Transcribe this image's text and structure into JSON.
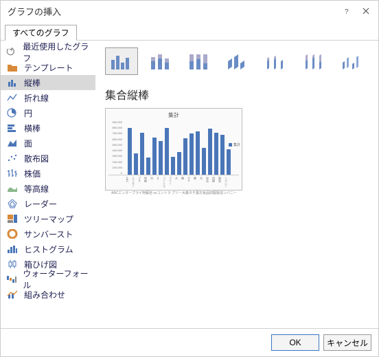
{
  "title": "グラフの挿入",
  "tab": "すべてのグラフ",
  "sidebar": {
    "items": [
      {
        "label": "最近使用したグラフ"
      },
      {
        "label": "テンプレート"
      },
      {
        "label": "縦棒"
      },
      {
        "label": "折れ線"
      },
      {
        "label": "円"
      },
      {
        "label": "横棒"
      },
      {
        "label": "面"
      },
      {
        "label": "散布図"
      },
      {
        "label": "株価"
      },
      {
        "label": "等高線"
      },
      {
        "label": "レーダー"
      },
      {
        "label": "ツリーマップ"
      },
      {
        "label": "サンバースト"
      },
      {
        "label": "ヒストグラム"
      },
      {
        "label": "箱ひげ図"
      },
      {
        "label": "ウォーターフォール"
      },
      {
        "label": "組み合わせ"
      }
    ]
  },
  "chart": {
    "selected_name": "集合縦棒",
    "preview_title": "集計",
    "legend": "集計",
    "footer": "ABCエンタープライ阿蘇自 ozコントラ プリー大藤タチ葉次良品四駆製造ンパニー"
  },
  "buttons": {
    "ok": "OK",
    "cancel": "キャンセル"
  },
  "chart_data": {
    "type": "bar",
    "title": "集計",
    "ylabel": "",
    "ylim": [
      0,
      900000
    ],
    "yticks": [
      "900,000",
      "800,000",
      "700,000",
      "600,000",
      "500,000",
      "400,000",
      "300,000",
      "200,000",
      "100,000",
      "0"
    ],
    "categories": [
      "ABC",
      "エンター",
      "プラ",
      "阿蘇",
      "自",
      "oz",
      "コントラ",
      "プリー",
      "大",
      "藤",
      "タチ",
      "葉",
      "次",
      "良品",
      "四駆",
      "製造",
      "ンパニー"
    ],
    "values": [
      780000,
      350000,
      700000,
      280000,
      620000,
      560000,
      780000,
      300000,
      380000,
      600000,
      680000,
      720000,
      450000,
      760000,
      700000,
      660000,
      420000
    ],
    "series": [
      {
        "name": "集計"
      }
    ]
  }
}
